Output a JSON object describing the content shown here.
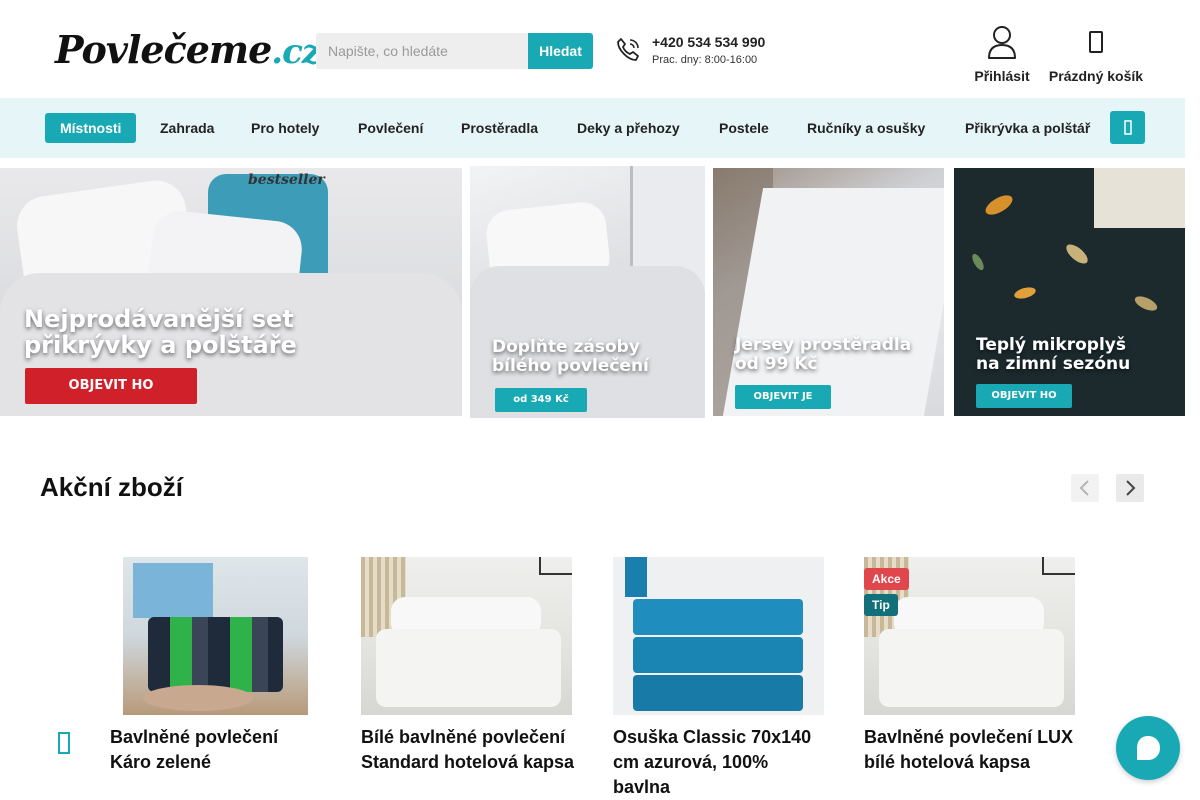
{
  "header": {
    "logo_text": "Povlečeme",
    "logo_suffix": ".cz",
    "search_placeholder": "Napište, co hledáte",
    "search_button": "Hledat",
    "phone_number": "+420 534 534 990",
    "phone_hours": "Prac. dny: 8:00-16:00",
    "login_label": "Přihlásit",
    "cart_label": "Prázdný košík"
  },
  "nav": {
    "items": [
      {
        "label": "Místnosti",
        "active": true
      },
      {
        "label": "Zahrada"
      },
      {
        "label": "Pro hotely"
      },
      {
        "label": "Povlečení"
      },
      {
        "label": "Prostěradla"
      },
      {
        "label": "Deky a přehozy"
      },
      {
        "label": "Postele"
      },
      {
        "label": "Ručníky a osušky"
      },
      {
        "label": "Přikrývka a polštář"
      }
    ],
    "more_icon": "chevron-down-icon"
  },
  "banners": [
    {
      "tag": "bestseller",
      "title_line1": "Nejprodávanější set",
      "title_line2": "přikrývky a polštáře",
      "button": "OBJEVIT HO"
    },
    {
      "title_line1": "Doplňte zásoby",
      "title_line2": "bílého povlečení",
      "button": "od 349 Kč"
    },
    {
      "title_line1": "Jersey prostěradla",
      "title_line2": "od 99 Kč",
      "button": "OBJEVIT JE"
    },
    {
      "title_line1": "Teplý mikroplyš",
      "title_line2": "na zimní sezónu",
      "button": "OBJEVIT HO"
    }
  ],
  "section": {
    "title": "Akční zboží"
  },
  "products": [
    {
      "name": "Bavlněné povlečení Káro zelené"
    },
    {
      "name": "Bílé bavlněné povlečení Standard hotelová kapsa"
    },
    {
      "name": "Osuška Classic 70x140 cm azurová, 100% bavlna"
    },
    {
      "name": "Bavlněné povlečení LUX bílé hotelová kapsa",
      "badges": [
        "Akce",
        "Tip"
      ]
    }
  ],
  "colors": {
    "accent": "#19a9b4",
    "nav_bg": "#e6f5f7",
    "badge_akce": "#e0474c",
    "badge_tip": "#11707a",
    "banner_red_button": "#d0202a"
  }
}
